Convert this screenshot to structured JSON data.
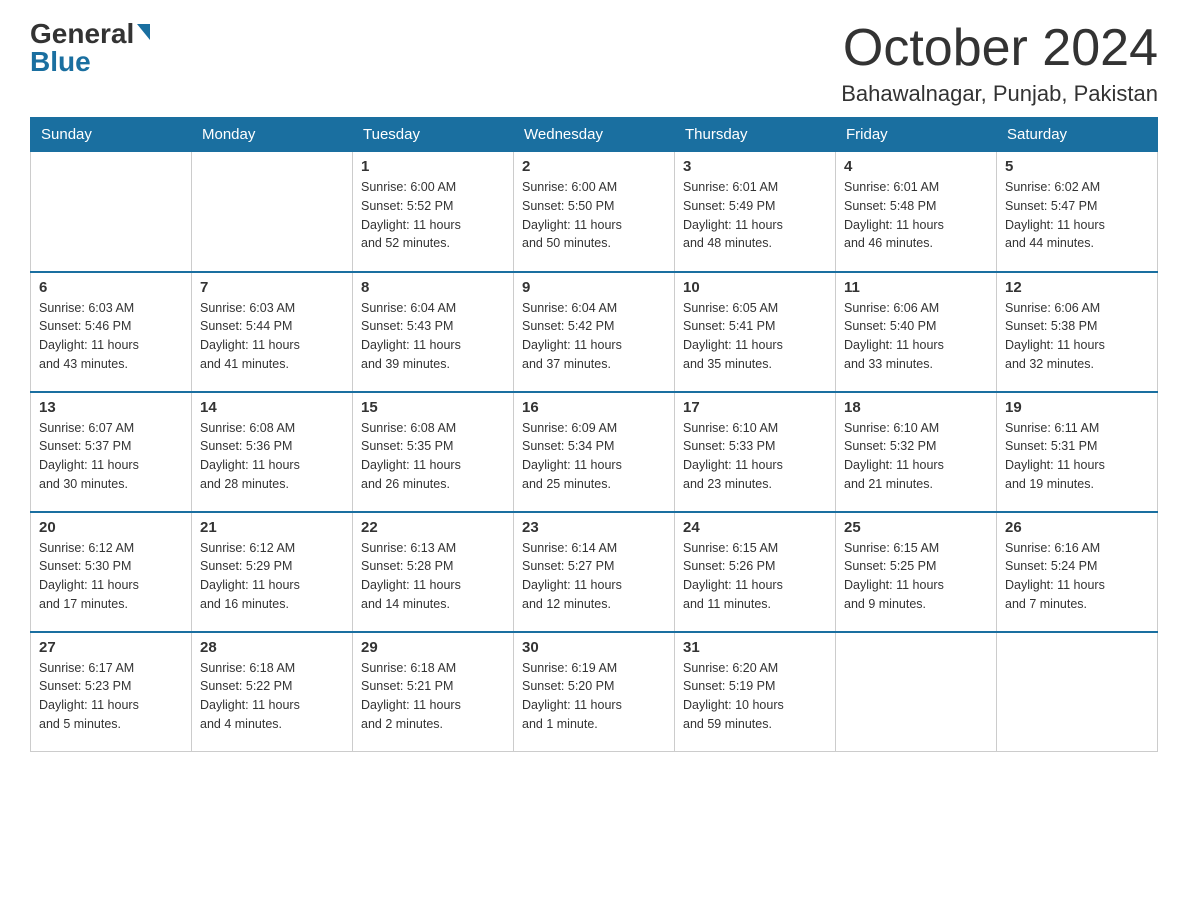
{
  "header": {
    "logo_line1": "General",
    "logo_line2": "Blue",
    "month_title": "October 2024",
    "location": "Bahawalnagar, Punjab, Pakistan"
  },
  "days_of_week": [
    "Sunday",
    "Monday",
    "Tuesday",
    "Wednesday",
    "Thursday",
    "Friday",
    "Saturday"
  ],
  "weeks": [
    [
      {
        "day": "",
        "info": ""
      },
      {
        "day": "",
        "info": ""
      },
      {
        "day": "1",
        "info": "Sunrise: 6:00 AM\nSunset: 5:52 PM\nDaylight: 11 hours\nand 52 minutes."
      },
      {
        "day": "2",
        "info": "Sunrise: 6:00 AM\nSunset: 5:50 PM\nDaylight: 11 hours\nand 50 minutes."
      },
      {
        "day": "3",
        "info": "Sunrise: 6:01 AM\nSunset: 5:49 PM\nDaylight: 11 hours\nand 48 minutes."
      },
      {
        "day": "4",
        "info": "Sunrise: 6:01 AM\nSunset: 5:48 PM\nDaylight: 11 hours\nand 46 minutes."
      },
      {
        "day": "5",
        "info": "Sunrise: 6:02 AM\nSunset: 5:47 PM\nDaylight: 11 hours\nand 44 minutes."
      }
    ],
    [
      {
        "day": "6",
        "info": "Sunrise: 6:03 AM\nSunset: 5:46 PM\nDaylight: 11 hours\nand 43 minutes."
      },
      {
        "day": "7",
        "info": "Sunrise: 6:03 AM\nSunset: 5:44 PM\nDaylight: 11 hours\nand 41 minutes."
      },
      {
        "day": "8",
        "info": "Sunrise: 6:04 AM\nSunset: 5:43 PM\nDaylight: 11 hours\nand 39 minutes."
      },
      {
        "day": "9",
        "info": "Sunrise: 6:04 AM\nSunset: 5:42 PM\nDaylight: 11 hours\nand 37 minutes."
      },
      {
        "day": "10",
        "info": "Sunrise: 6:05 AM\nSunset: 5:41 PM\nDaylight: 11 hours\nand 35 minutes."
      },
      {
        "day": "11",
        "info": "Sunrise: 6:06 AM\nSunset: 5:40 PM\nDaylight: 11 hours\nand 33 minutes."
      },
      {
        "day": "12",
        "info": "Sunrise: 6:06 AM\nSunset: 5:38 PM\nDaylight: 11 hours\nand 32 minutes."
      }
    ],
    [
      {
        "day": "13",
        "info": "Sunrise: 6:07 AM\nSunset: 5:37 PM\nDaylight: 11 hours\nand 30 minutes."
      },
      {
        "day": "14",
        "info": "Sunrise: 6:08 AM\nSunset: 5:36 PM\nDaylight: 11 hours\nand 28 minutes."
      },
      {
        "day": "15",
        "info": "Sunrise: 6:08 AM\nSunset: 5:35 PM\nDaylight: 11 hours\nand 26 minutes."
      },
      {
        "day": "16",
        "info": "Sunrise: 6:09 AM\nSunset: 5:34 PM\nDaylight: 11 hours\nand 25 minutes."
      },
      {
        "day": "17",
        "info": "Sunrise: 6:10 AM\nSunset: 5:33 PM\nDaylight: 11 hours\nand 23 minutes."
      },
      {
        "day": "18",
        "info": "Sunrise: 6:10 AM\nSunset: 5:32 PM\nDaylight: 11 hours\nand 21 minutes."
      },
      {
        "day": "19",
        "info": "Sunrise: 6:11 AM\nSunset: 5:31 PM\nDaylight: 11 hours\nand 19 minutes."
      }
    ],
    [
      {
        "day": "20",
        "info": "Sunrise: 6:12 AM\nSunset: 5:30 PM\nDaylight: 11 hours\nand 17 minutes."
      },
      {
        "day": "21",
        "info": "Sunrise: 6:12 AM\nSunset: 5:29 PM\nDaylight: 11 hours\nand 16 minutes."
      },
      {
        "day": "22",
        "info": "Sunrise: 6:13 AM\nSunset: 5:28 PM\nDaylight: 11 hours\nand 14 minutes."
      },
      {
        "day": "23",
        "info": "Sunrise: 6:14 AM\nSunset: 5:27 PM\nDaylight: 11 hours\nand 12 minutes."
      },
      {
        "day": "24",
        "info": "Sunrise: 6:15 AM\nSunset: 5:26 PM\nDaylight: 11 hours\nand 11 minutes."
      },
      {
        "day": "25",
        "info": "Sunrise: 6:15 AM\nSunset: 5:25 PM\nDaylight: 11 hours\nand 9 minutes."
      },
      {
        "day": "26",
        "info": "Sunrise: 6:16 AM\nSunset: 5:24 PM\nDaylight: 11 hours\nand 7 minutes."
      }
    ],
    [
      {
        "day": "27",
        "info": "Sunrise: 6:17 AM\nSunset: 5:23 PM\nDaylight: 11 hours\nand 5 minutes."
      },
      {
        "day": "28",
        "info": "Sunrise: 6:18 AM\nSunset: 5:22 PM\nDaylight: 11 hours\nand 4 minutes."
      },
      {
        "day": "29",
        "info": "Sunrise: 6:18 AM\nSunset: 5:21 PM\nDaylight: 11 hours\nand 2 minutes."
      },
      {
        "day": "30",
        "info": "Sunrise: 6:19 AM\nSunset: 5:20 PM\nDaylight: 11 hours\nand 1 minute."
      },
      {
        "day": "31",
        "info": "Sunrise: 6:20 AM\nSunset: 5:19 PM\nDaylight: 10 hours\nand 59 minutes."
      },
      {
        "day": "",
        "info": ""
      },
      {
        "day": "",
        "info": ""
      }
    ]
  ]
}
